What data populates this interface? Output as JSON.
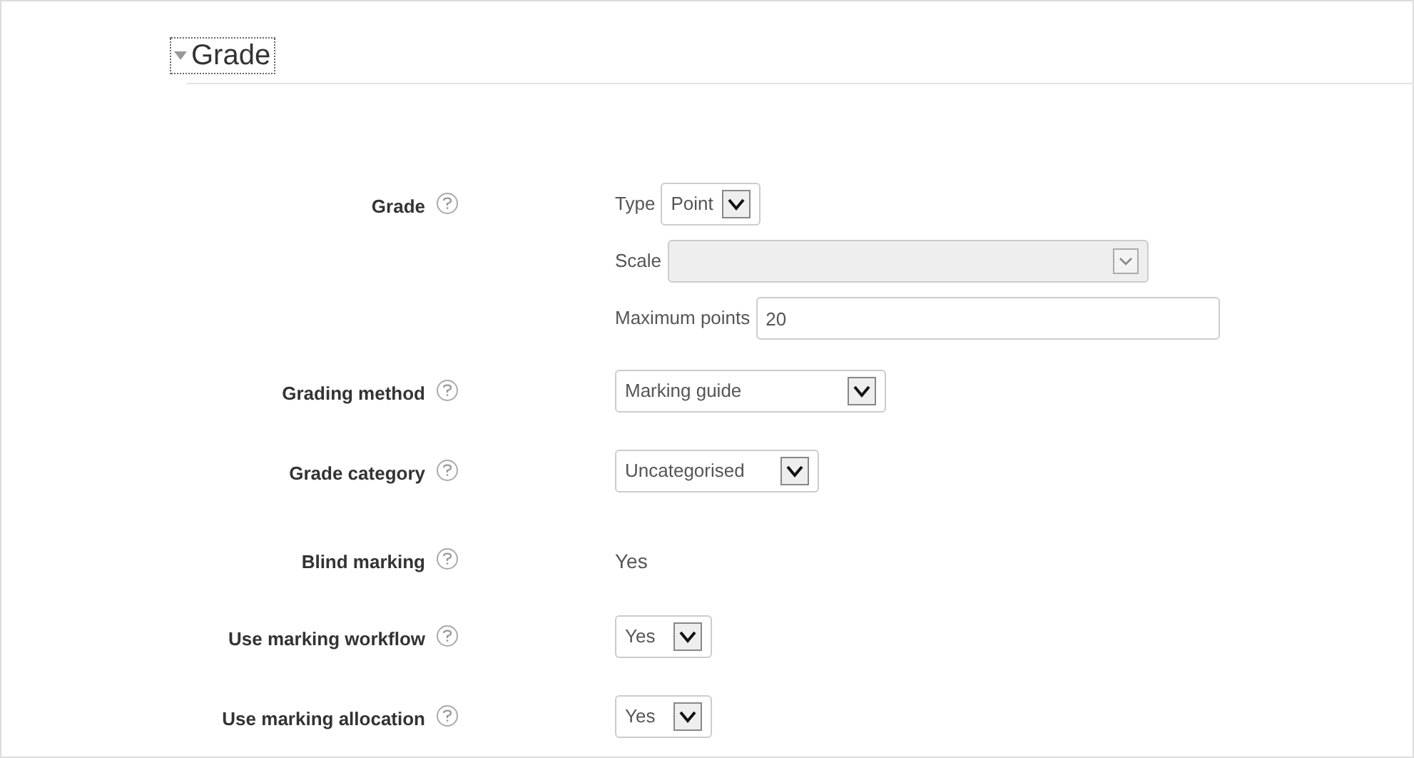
{
  "section": {
    "title": "Grade",
    "expanded": true
  },
  "rows": [
    {
      "kind": "group",
      "label": "Grade",
      "fields": [
        {
          "kind": "select",
          "label": "Type",
          "value": "Point",
          "disabled": false
        },
        {
          "kind": "select",
          "label": "Scale",
          "disabled": true
        },
        {
          "kind": "text",
          "label": "Maximum points",
          "value": "20"
        }
      ]
    },
    {
      "kind": "select",
      "label": "Grading method",
      "value": "Marking guide",
      "disabled": false
    },
    {
      "kind": "select",
      "label": "Grade category",
      "value": "Uncategorised",
      "disabled": false
    },
    {
      "kind": "static",
      "label": "Blind marking",
      "value": "Yes"
    },
    {
      "kind": "select",
      "label": "Use marking workflow",
      "value": "Yes",
      "disabled": false
    },
    {
      "kind": "select",
      "label": "Use marking allocation",
      "value": "Yes",
      "disabled": false
    }
  ]
}
